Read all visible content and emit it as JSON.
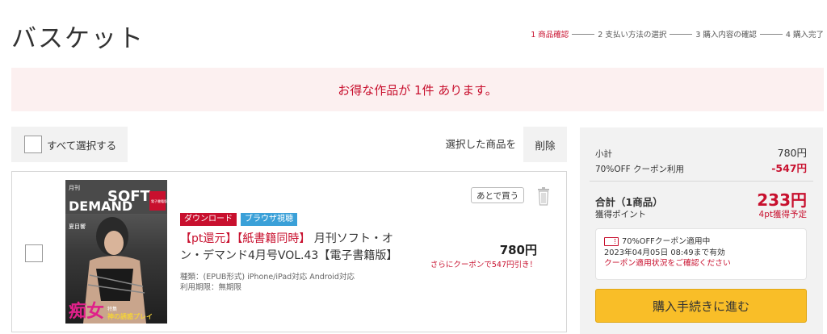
{
  "page": {
    "title": "バスケット"
  },
  "steps": [
    {
      "label": "1 商品確認",
      "active": true
    },
    {
      "label": "2 支払い方法の選択",
      "active": false
    },
    {
      "label": "3 購入内容の確認",
      "active": false
    },
    {
      "label": "4 購入完了",
      "active": false
    }
  ],
  "notice": {
    "text": "お得な作品が 1件 あります。"
  },
  "selection": {
    "select_all_label": "すべて選択する",
    "selected_items_label": "選択した商品を",
    "delete_label": "削除"
  },
  "item": {
    "badges": [
      "ダウンロード",
      "ブラウザ視聴"
    ],
    "title_highlight": "【pt還元】【紙書籍同時】",
    "title_rest": " 月刊ソフト・オン・デマンド4月号VOL.43【電子書籍版】",
    "format": "種類：(EPUB形式) iPhone/iPad対応 Android対応",
    "period": "利用期限：無期限",
    "later_label": "あとで買う",
    "price": "780円",
    "coupon_note": "さらにクーポンで547円引き！",
    "cover_text": {
      "monthly": "月刊",
      "brand_top": "SOFT",
      "brand_bottom": "DEMAND",
      "ad_caption": "電子書籍版",
      "name": "夏目響",
      "headline": "痴女",
      "tag": "特集",
      "tagline": "神の誘惑プレイ"
    }
  },
  "summary": {
    "subtotal_label": "小計",
    "subtotal_value": "780円",
    "coupon_label": "70%OFF クーポン利用",
    "coupon_value": "-547円",
    "total_label": "合計（1商品）",
    "total_value": "233円",
    "points_label": "獲得ポイント",
    "points_value": "4pt獲得予定",
    "coupon_box": {
      "title": "70%OFFクーポン適用中",
      "expiry": "2023年04月05日 08:49まで有効",
      "link": "クーポン適用状況をご確認ください"
    },
    "proceed_label": "購入手続きに進む"
  },
  "colors": {
    "accent": "#c8102e",
    "cta": "#f9be28",
    "info": "#3aa0d8",
    "notice_bg": "#fcf0f0"
  },
  "icons": [
    "checkbox",
    "trash-icon",
    "coupon-ticket-icon"
  ]
}
